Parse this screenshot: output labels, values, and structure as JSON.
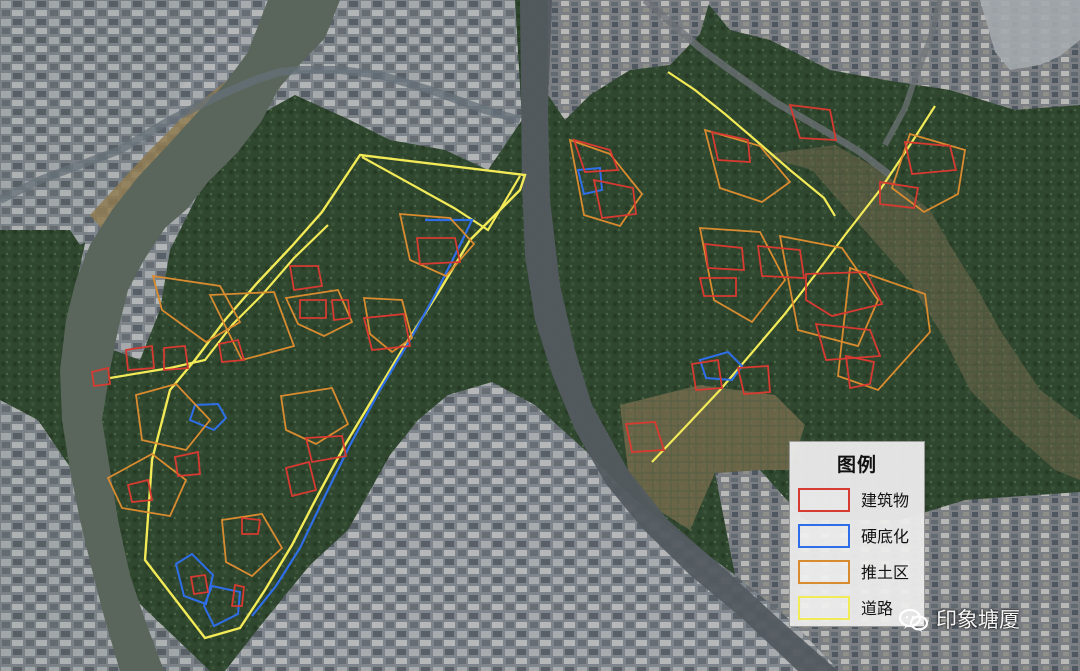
{
  "legend": {
    "title": "图例",
    "items": [
      {
        "label": "建筑物",
        "color": "#d73a31"
      },
      {
        "label": "硬底化",
        "color": "#2e6ee8"
      },
      {
        "label": "推土区",
        "color": "#d98b2f"
      },
      {
        "label": "道路",
        "color": "#f2ea56"
      }
    ]
  },
  "watermark": {
    "text": "印象塘厦",
    "icon": "wechat-icon"
  },
  "colors": {
    "vegetation": "#30472f",
    "river": "#59675c",
    "urban": "#8b8f94",
    "bare_soil": "#8d7650",
    "road": "#555b61"
  }
}
